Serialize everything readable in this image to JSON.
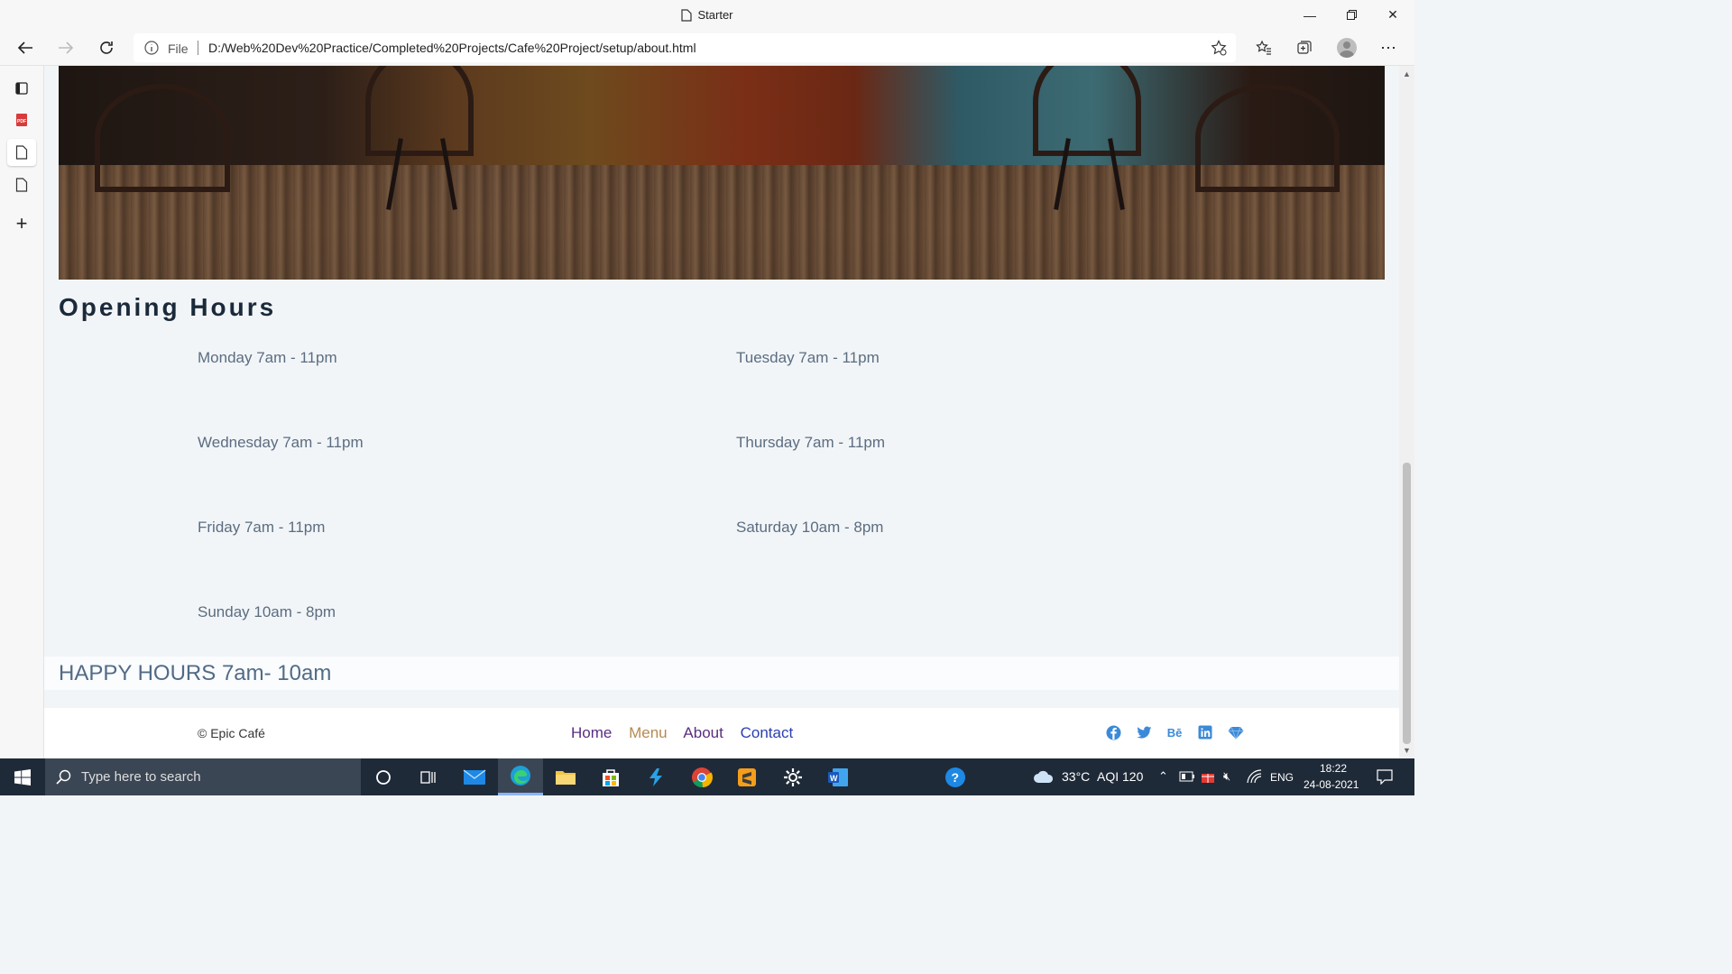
{
  "window": {
    "title": "Starter"
  },
  "address_bar": {
    "scheme_label": "File",
    "url": "D:/Web%20Dev%20Practice/Completed%20Projects/Cafe%20Project/setup/about.html"
  },
  "page": {
    "heading": "Opening Hours",
    "hours": [
      "Monday 7am - 11pm",
      "Tuesday 7am - 11pm",
      "Wednesday 7am - 11pm",
      "Thursday 7am - 11pm",
      "Friday 7am - 11pm",
      "Saturday 10am - 8pm",
      "Sunday 10am - 8pm"
    ],
    "happy_hours": "HAPPY HOURS 7am- 10am"
  },
  "footer": {
    "copyright": "© Epic Café",
    "links": [
      "Home",
      "Menu",
      "About",
      "Contact"
    ],
    "link_colors": [
      "#5a2d82",
      "#b58a52",
      "#5a2d82",
      "#2a3fb0"
    ],
    "social_icons": [
      "facebook-icon",
      "twitter-icon",
      "behance-icon",
      "linkedin-icon",
      "sketch-icon"
    ],
    "social_labels": [
      "f",
      "t",
      "Bē",
      "in",
      "◆"
    ]
  },
  "taskbar": {
    "search_placeholder": "Type here to search",
    "weather": "33°C",
    "aqi": "AQI 120",
    "language": "ENG",
    "time": "18:22",
    "date": "24-08-2021"
  },
  "colors": {
    "accent": "#3b8ad8",
    "heading": "#1b2a3a",
    "body_text": "#5b6d80"
  }
}
